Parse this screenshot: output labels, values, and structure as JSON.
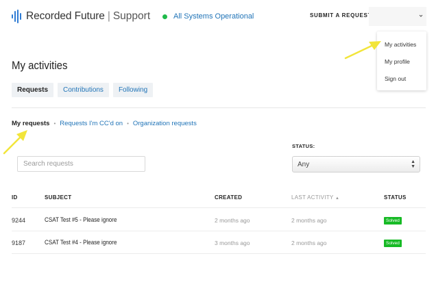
{
  "header": {
    "brand_name": "Recorded Future",
    "separator": "|",
    "brand_suffix": "Support",
    "status_text": "All Systems Operational",
    "submit_request": "SUBMIT A REQUEST"
  },
  "user_menu": {
    "items": [
      {
        "label": "My activities"
      },
      {
        "label": "My profile"
      },
      {
        "label": "Sign out"
      }
    ]
  },
  "page": {
    "title": "My activities",
    "tabs": [
      {
        "label": "Requests",
        "active": true
      },
      {
        "label": "Contributions",
        "active": false
      },
      {
        "label": "Following",
        "active": false
      }
    ],
    "subnav": [
      {
        "label": "My requests",
        "active": true
      },
      {
        "label": "Requests I'm CC'd on",
        "active": false
      },
      {
        "label": "Organization requests",
        "active": false
      }
    ],
    "search": {
      "placeholder": "Search requests",
      "value": ""
    },
    "status_filter": {
      "label": "STATUS:",
      "selected": "Any"
    }
  },
  "table": {
    "columns": {
      "id": "ID",
      "subject": "SUBJECT",
      "created": "CREATED",
      "last_activity": "LAST ACTIVITY",
      "status": "STATUS"
    },
    "rows": [
      {
        "id": "9244",
        "subject": "CSAT Test #5 - Please ignore",
        "created": "2 months ago",
        "last_activity": "2 months ago",
        "status": "Solved"
      },
      {
        "id": "9187",
        "subject": "CSAT Test #4 - Please ignore",
        "created": "3 months ago",
        "last_activity": "2 months ago",
        "status": "Solved"
      }
    ]
  },
  "colors": {
    "link": "#1f73b7",
    "status_ok": "#1fba4a",
    "solved_badge": "#17ba25",
    "annotation_arrow": "#f2e53a"
  }
}
